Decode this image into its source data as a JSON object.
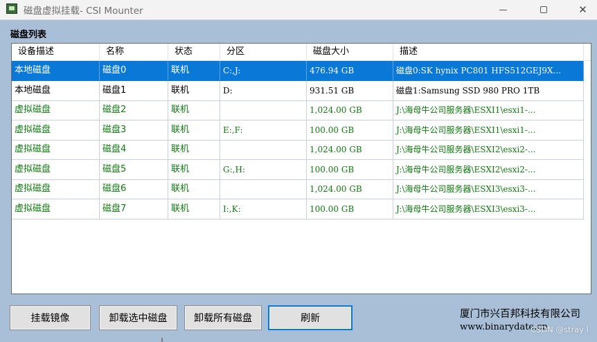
{
  "window": {
    "title": "磁盘虚拟挂载- CSI Mounter",
    "minimize_glyph": "—",
    "maximize_glyph": "☐",
    "close_glyph": "✕"
  },
  "section_label": "磁盘列表",
  "list": {
    "columns": [
      "设备描述",
      "名称",
      "状态",
      "分区",
      "磁盘大小",
      "描述"
    ],
    "rows": [
      {
        "device": "本地磁盘",
        "name": "磁盘0",
        "status": "联机",
        "partition": "C:,J:",
        "size": "476.94 GB",
        "desc": "磁盘0:SK hynix PC801 HFS512GEJ9X...",
        "kind": "local",
        "selected": true
      },
      {
        "device": "本地磁盘",
        "name": "磁盘1",
        "status": "联机",
        "partition": "D:",
        "size": "931.51 GB",
        "desc": "磁盘1:Samsung SSD 980 PRO 1TB",
        "kind": "local",
        "selected": false
      },
      {
        "device": "虚拟磁盘",
        "name": "磁盘2",
        "status": "联机",
        "partition": "",
        "size": "1,024.00 GB",
        "desc": "J:\\海母牛公司服务器\\ESXI1\\esxi1-...",
        "kind": "virtual",
        "selected": false
      },
      {
        "device": "虚拟磁盘",
        "name": "磁盘3",
        "status": "联机",
        "partition": "E:,F:",
        "size": "100.00 GB",
        "desc": "J:\\海母牛公司服务器\\ESXI1\\esxi1-...",
        "kind": "virtual",
        "selected": false
      },
      {
        "device": "虚拟磁盘",
        "name": "磁盘4",
        "status": "联机",
        "partition": "",
        "size": "1,024.00 GB",
        "desc": "J:\\海母牛公司服务器\\ESXI2\\esxi2-...",
        "kind": "virtual",
        "selected": false
      },
      {
        "device": "虚拟磁盘",
        "name": "磁盘5",
        "status": "联机",
        "partition": "G:,H:",
        "size": "100.00 GB",
        "desc": "J:\\海母牛公司服务器\\ESXI2\\esxi2-...",
        "kind": "virtual",
        "selected": false
      },
      {
        "device": "虚拟磁盘",
        "name": "磁盘6",
        "status": "联机",
        "partition": "",
        "size": "1,024.00 GB",
        "desc": "J:\\海母牛公司服务器\\ESXI3\\esxi3-...",
        "kind": "virtual",
        "selected": false
      },
      {
        "device": "虚拟磁盘",
        "name": "磁盘7",
        "status": "联机",
        "partition": "I:,K:",
        "size": "100.00 GB",
        "desc": "J:\\海母牛公司服务器\\ESXI3\\esxi3-...",
        "kind": "virtual",
        "selected": false
      }
    ]
  },
  "buttons": {
    "mount_image": "挂载镜像",
    "unmount_selected": "卸载选中磁盘",
    "unmount_all": "卸载所有磁盘",
    "refresh": "刷新"
  },
  "footer": {
    "company": "厦门市兴百邦科技有限公司",
    "website": "www.binarydate.cn",
    "watermark": "CSDN @stray l"
  },
  "colors": {
    "selection": "#0a78d7",
    "virtual_text": "#0e7a0e",
    "form_background": "#a9bfd8"
  }
}
